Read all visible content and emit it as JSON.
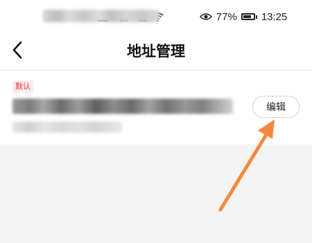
{
  "status_bar": {
    "hd_label": "HD",
    "sim1_gen": "4G",
    "sim2_gen": "5G",
    "battery_percent": "77%",
    "battery_level": 0.77,
    "time": "13:25",
    "icons": [
      "hd-icon",
      "signal-icon",
      "wifi-icon",
      "eye-icon",
      "battery-icon"
    ]
  },
  "header": {
    "title": "地址管理",
    "back_icon": "chevron-left-icon"
  },
  "address": {
    "default_tag": "默认",
    "edit_label": "编辑"
  },
  "annotation": {
    "arrow_color": "#f5883a",
    "icon": "arrow-icon"
  },
  "colors": {
    "page_background": "#f4f4f4",
    "card_background": "#ffffff",
    "tag_text": "#e0393e",
    "tag_background": "#fde9ea"
  }
}
